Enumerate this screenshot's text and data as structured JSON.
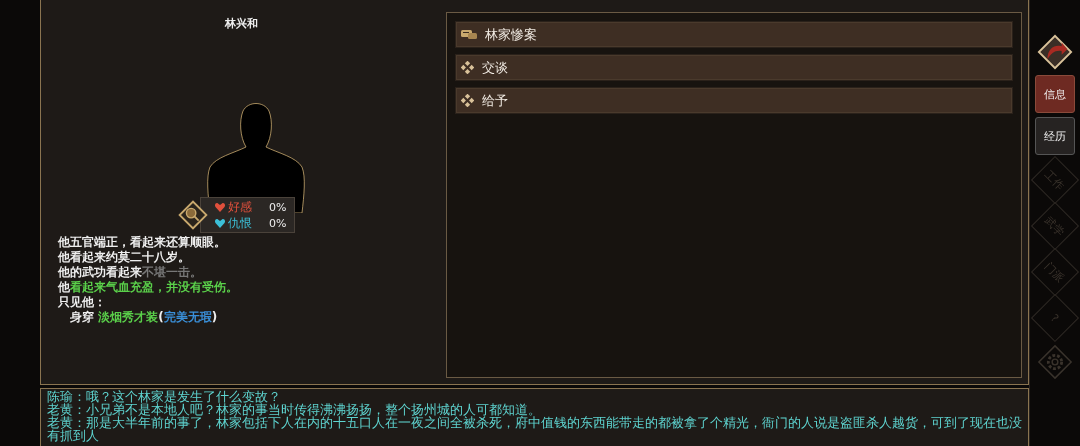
{
  "character": {
    "name": "林兴和",
    "stats": [
      {
        "label": "好感",
        "value": "0%",
        "color": "#e0503c"
      },
      {
        "label": "仇恨",
        "value": "0%",
        "color": "#3cc0d8"
      }
    ],
    "description": [
      [
        {
          "text": "他五官端正，看起来还算顺眼。",
          "color": "#eeeeee"
        }
      ],
      [
        {
          "text": "他看起来约莫二十八岁。",
          "color": "#eeeeee"
        }
      ],
      [
        {
          "text": "他的武功看起来",
          "color": "#eeeeee"
        },
        {
          "text": "不堪一击。",
          "color": "#777777"
        }
      ],
      [
        {
          "text": "他",
          "color": "#eeeeee"
        },
        {
          "text": "看起来气血充盈，并没有受伤。",
          "color": "#5ad04a"
        }
      ],
      [
        {
          "text": "只见他：",
          "color": "#eeeeee"
        }
      ],
      [
        {
          "text": "　身穿 ",
          "color": "#eeeeee"
        },
        {
          "text": "淡烟秀才装",
          "color": "#5ad04a"
        },
        {
          "text": "(",
          "color": "#eeeeee"
        },
        {
          "text": "完美无瑕",
          "color": "#3a8fd8"
        },
        {
          "text": ")",
          "color": "#eeeeee"
        }
      ]
    ]
  },
  "options": [
    {
      "label": "林家惨案",
      "kind": "topic"
    },
    {
      "label": "交谈",
      "kind": "action"
    },
    {
      "label": "给予",
      "kind": "action"
    }
  ],
  "side_tabs": [
    {
      "label": "信息",
      "kind": "tab",
      "selected": true,
      "disabled": false
    },
    {
      "label": "经历",
      "kind": "tab",
      "selected": false,
      "disabled": false
    },
    {
      "label": "工作",
      "kind": "diamond",
      "selected": false,
      "disabled": true
    },
    {
      "label": "武学",
      "kind": "diamond",
      "selected": false,
      "disabled": true
    },
    {
      "label": "门派",
      "kind": "diamond",
      "selected": false,
      "disabled": true
    },
    {
      "label": "?",
      "kind": "diamond",
      "selected": false,
      "disabled": true
    }
  ],
  "log": [
    "陈瑜：哦？这个林家是发生了什么变故？",
    "老黄：小兄弟不是本地人吧？林家的事当时传得沸沸扬扬，整个扬州城的人可都知道。",
    "老黄：那是大半年前的事了，林家包括下人在内的十五口人在一夜之间全被杀死，府中值钱的东西能带走的都被拿了个精光，衙门的人说是盗匪杀人越货，可到了现在也没有抓到人"
  ]
}
